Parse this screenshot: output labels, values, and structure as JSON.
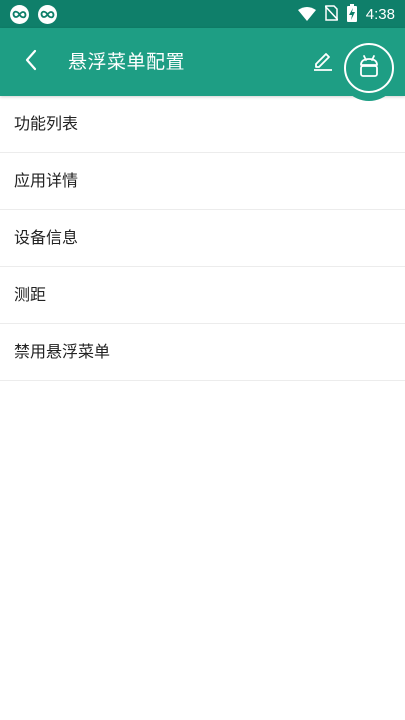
{
  "status_bar": {
    "time": "4:38",
    "notification_icons": [
      "infinity-logo-icon",
      "infinity-logo-icon"
    ],
    "system_icons": [
      "wifi-icon",
      "no-sim-icon",
      "battery-charging-icon"
    ],
    "color": "#0f7f6a"
  },
  "app_bar": {
    "title": "悬浮菜单配置",
    "back_icon": "back-arrow-icon",
    "edit_icon": "pencil-icon",
    "float_icon": "android-robot-icon",
    "color": "#1e9e84"
  },
  "menu": {
    "items": [
      {
        "label": "功能列表"
      },
      {
        "label": "应用详情"
      },
      {
        "label": "设备信息"
      },
      {
        "label": "测距"
      },
      {
        "label": "禁用悬浮菜单"
      }
    ]
  }
}
